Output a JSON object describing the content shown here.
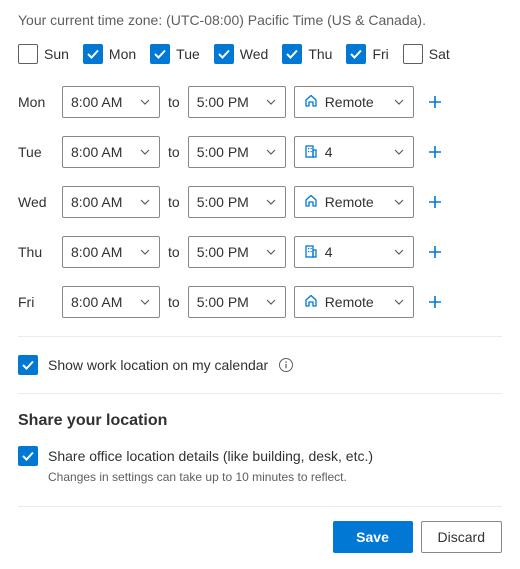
{
  "timezone_text": "Your current time zone: (UTC-08:00) Pacific Time (US & Canada).",
  "days": [
    {
      "abbr": "Sun",
      "checked": false
    },
    {
      "abbr": "Mon",
      "checked": true
    },
    {
      "abbr": "Tue",
      "checked": true
    },
    {
      "abbr": "Wed",
      "checked": true
    },
    {
      "abbr": "Thu",
      "checked": true
    },
    {
      "abbr": "Fri",
      "checked": true
    },
    {
      "abbr": "Sat",
      "checked": false
    }
  ],
  "to_label": "to",
  "schedule": [
    {
      "day": "Mon",
      "start": "8:00 AM",
      "end": "5:00 PM",
      "loc_type": "remote",
      "loc_label": "Remote"
    },
    {
      "day": "Tue",
      "start": "8:00 AM",
      "end": "5:00 PM",
      "loc_type": "office",
      "loc_label": "4"
    },
    {
      "day": "Wed",
      "start": "8:00 AM",
      "end": "5:00 PM",
      "loc_type": "remote",
      "loc_label": "Remote"
    },
    {
      "day": "Thu",
      "start": "8:00 AM",
      "end": "5:00 PM",
      "loc_type": "office",
      "loc_label": "4"
    },
    {
      "day": "Fri",
      "start": "8:00 AM",
      "end": "5:00 PM",
      "loc_type": "remote",
      "loc_label": "Remote"
    }
  ],
  "show_location_label": "Show work location on my calendar",
  "share_section_title": "Share your location",
  "share_details_label": "Share office location details (like building, desk, etc.)",
  "share_hint": "Changes in settings can take up to 10 minutes to reflect.",
  "buttons": {
    "save": "Save",
    "discard": "Discard"
  },
  "colors": {
    "primary": "#0078d4"
  }
}
